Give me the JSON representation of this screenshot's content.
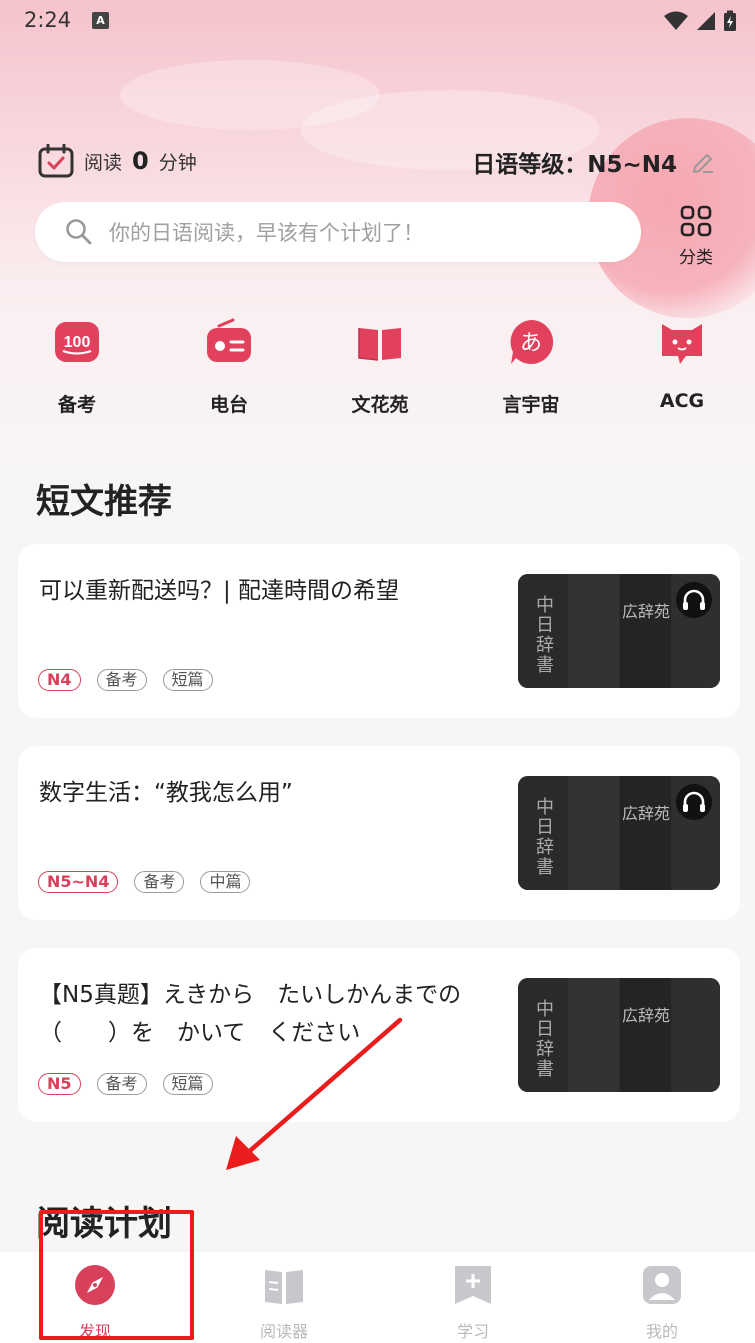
{
  "status_bar": {
    "time": "2:24",
    "app_badge": "A"
  },
  "header": {
    "reading_label": "阅读",
    "reading_minutes": "0",
    "reading_unit": "分钟",
    "level_text": "日语等级：N5~N4"
  },
  "search": {
    "placeholder": "你的日语阅读，早该有个计划了！"
  },
  "category": {
    "label": "分类"
  },
  "quick_nav": [
    {
      "label": "备考",
      "icon": "exam-100-icon",
      "badge": "100"
    },
    {
      "label": "电台",
      "icon": "radio-icon"
    },
    {
      "label": "文花苑",
      "icon": "book-open-icon"
    },
    {
      "label": "言宇宙",
      "icon": "hiragana-a-icon",
      "badge": "あ"
    },
    {
      "label": "ACG",
      "icon": "cat-face-icon"
    }
  ],
  "sections": {
    "short_title": "短文推荐",
    "plan_title": "阅读计划"
  },
  "articles": [
    {
      "title": "可以重新配送吗？| 配達時間の希望",
      "tags": [
        "N4",
        "备考",
        "短篇"
      ],
      "has_audio": true,
      "thumb_text_1": "中日辞書",
      "thumb_text_2": "広辞苑"
    },
    {
      "title": "数字生活：“教我怎么用”",
      "tags": [
        "N5~N4",
        "备考",
        "中篇"
      ],
      "has_audio": true,
      "thumb_text_1": "中日辞書",
      "thumb_text_2": "広辞苑"
    },
    {
      "title": "【N5真题】えきから　たいしかんまでの（　　）を　かいて　ください",
      "tags": [
        "N5",
        "备考",
        "短篇"
      ],
      "has_audio": false,
      "thumb_text_1": "中日辞書",
      "thumb_text_2": "広辞苑"
    }
  ],
  "bottom_nav": [
    {
      "label": "发现",
      "icon": "compass-icon",
      "active": true
    },
    {
      "label": "阅读器",
      "icon": "reader-book-icon",
      "active": false
    },
    {
      "label": "学习",
      "icon": "bookmark-plus-icon",
      "active": false
    },
    {
      "label": "我的",
      "icon": "user-icon",
      "active": false
    }
  ],
  "colors": {
    "accent": "#d8405b",
    "annotation": "#ea1c1c",
    "hero_top": "#f5c3cc"
  }
}
